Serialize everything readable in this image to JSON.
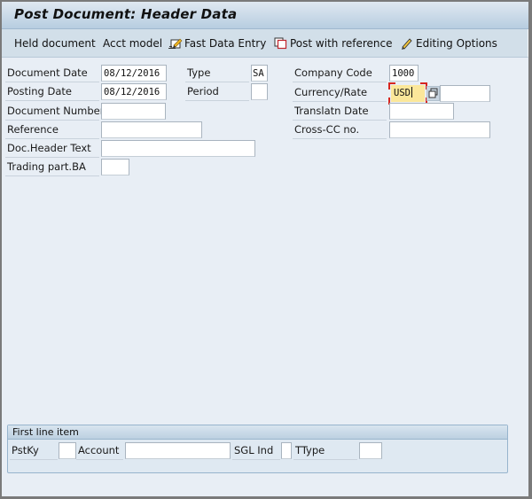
{
  "window": {
    "title": "Post Document: Header Data"
  },
  "toolbar": {
    "items": [
      {
        "label": "Held document",
        "icon": null
      },
      {
        "label": "Acct model",
        "icon": null
      },
      {
        "label": "Fast Data Entry",
        "icon": "fast-entry-icon"
      },
      {
        "label": "Post with reference",
        "icon": "copy-document-icon"
      },
      {
        "label": "Editing Options",
        "icon": "pencil-icon"
      }
    ]
  },
  "header": {
    "document_date": {
      "label": "Document Date",
      "value": "08/12/2016"
    },
    "posting_date": {
      "label": "Posting Date",
      "value": "08/12/2016"
    },
    "document_number": {
      "label": "Document Number",
      "value": ""
    },
    "reference": {
      "label": "Reference",
      "value": ""
    },
    "doc_header_text": {
      "label": "Doc.Header Text",
      "value": ""
    },
    "trading_part_ba": {
      "label": "Trading part.BA",
      "value": ""
    },
    "type": {
      "label": "Type",
      "value": "SA"
    },
    "period": {
      "label": "Period",
      "value": ""
    },
    "company_code": {
      "label": "Company Code",
      "value": "1000"
    },
    "currency_rate": {
      "label": "Currency/Rate",
      "currency": "USD",
      "rate": "",
      "help_icon": "value-help-icon"
    },
    "translatn_date": {
      "label": "Translatn Date",
      "value": ""
    },
    "cross_cc_no": {
      "label": "Cross-CC no.",
      "value": ""
    }
  },
  "first_line_item": {
    "title": "First line item",
    "pstky": {
      "label": "PstKy",
      "value": ""
    },
    "account": {
      "label": "Account",
      "value": ""
    },
    "sgl_ind": {
      "label": "SGL Ind",
      "value": ""
    },
    "ttype": {
      "label": "TType",
      "value": ""
    }
  },
  "colors": {
    "focus_field": "#fbe79a",
    "focus_marker": "#d7261f",
    "toolbar_bg": "#d2dfe9",
    "canvas_bg": "#e8eef5"
  }
}
